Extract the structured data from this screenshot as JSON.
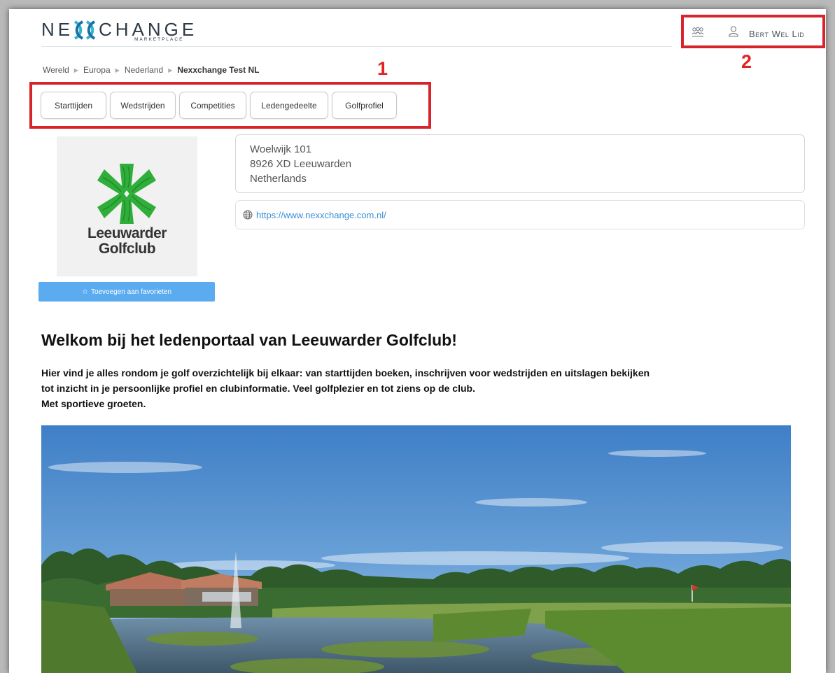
{
  "header": {
    "logo_left": "NE",
    "logo_right": "CHANGE",
    "logo_sub": "MARKETPLACE",
    "user_name": "Bert Wel Lid",
    "icons": [
      "group-icon",
      "user-icon"
    ]
  },
  "annotations": {
    "label_1": "1",
    "label_2": "2",
    "color": "#d6242a"
  },
  "breadcrumb": {
    "items": [
      "Wereld",
      "Europa",
      "Nederland"
    ],
    "current": "Nexxchange Test NL"
  },
  "tabs": [
    "Starttijden",
    "Wedstrijden",
    "Competities",
    "Ledengedeelte",
    "Golfprofiel"
  ],
  "club": {
    "name_line1": "Leeuwarder",
    "name_line2": "Golfclub",
    "favorite_label": "Toevoegen aan favorieten",
    "brand_color": "#2fae3a"
  },
  "address": {
    "line1": "Woelwijk 101",
    "line2": "8926 XD Leeuwarden",
    "line3": "Netherlands",
    "url": "https://www.nexxchange.com.nl/"
  },
  "welcome": {
    "title": "Welkom bij het ledenportaal van Leeuwarder Golfclub!",
    "line1": "Hier vind je alles rondom je golf overzichtelijk bij elkaar: van starttijden boeken, inschrijven voor wedstrijden en uitslagen bekijken",
    "line2": "tot inzicht in je persoonlijke profiel en clubinformatie. Veel golfplezier en tot ziens op de club.",
    "line3": "Met sportieve groeten."
  }
}
